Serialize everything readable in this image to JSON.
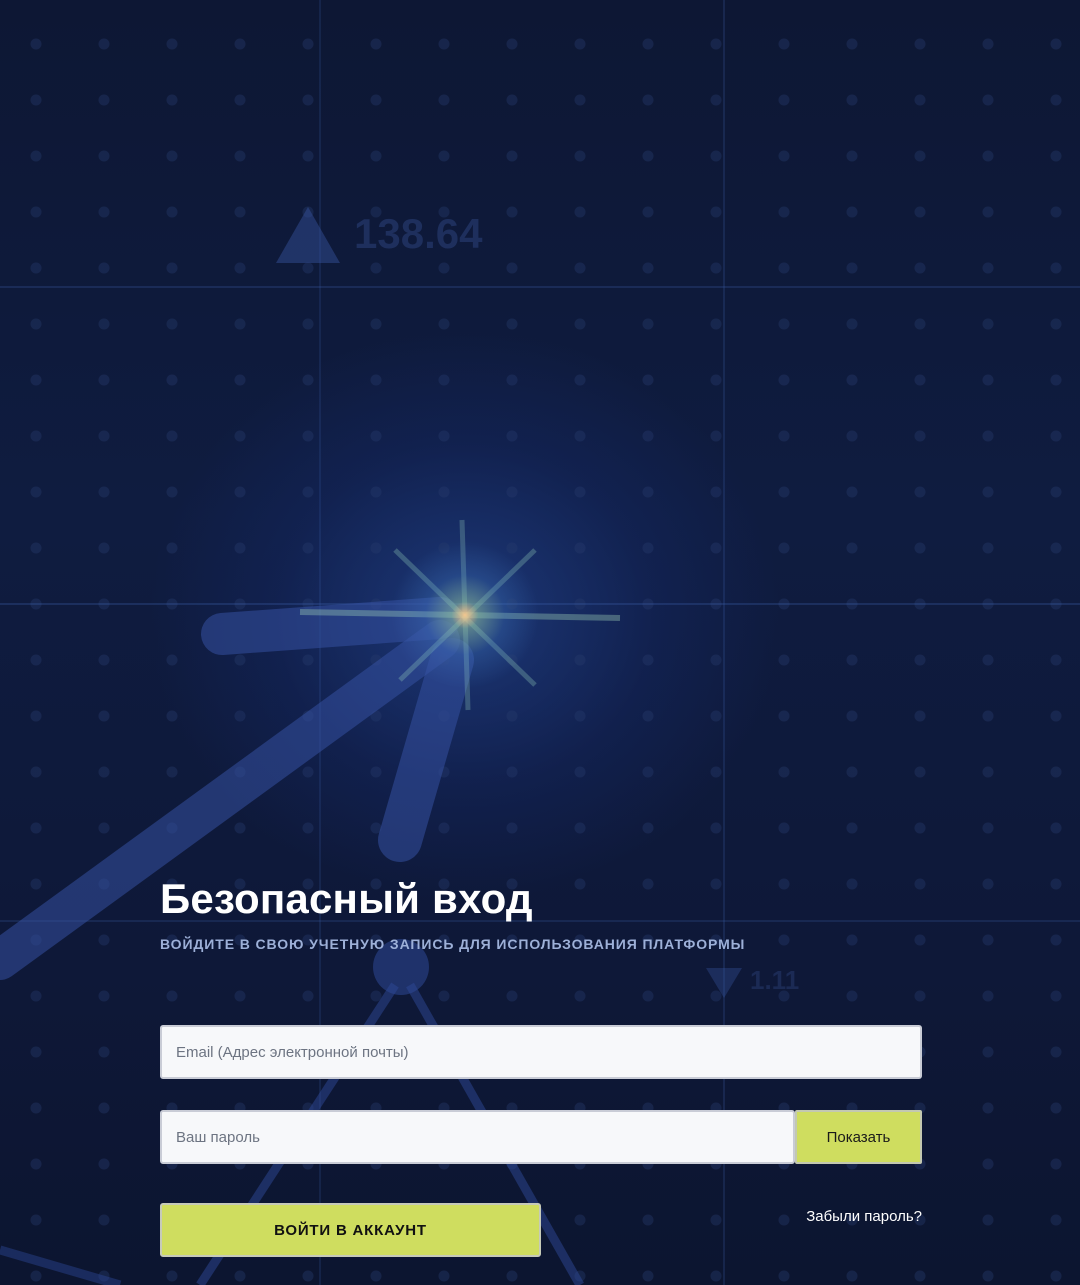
{
  "background": {
    "ticker_up_value": "138.64",
    "ticker_down_value": "1.11",
    "accent_color": "#cfdd5f",
    "base_color": "#0d1733"
  },
  "login": {
    "title": "Безопасный вход",
    "subtitle": "ВОЙДИТЕ В СВОЮ УЧЕТНУЮ ЗАПИСЬ ДЛЯ ИСПОЛЬЗОВАНИЯ ПЛАТФОРМЫ",
    "email_placeholder": "Email (Адрес электронной почты)",
    "email_value": "",
    "password_placeholder": "Ваш пароль",
    "password_value": "",
    "show_password_label": "Показать",
    "submit_label": "ВОЙТИ В АККАУНТ",
    "forgot_password_label": "Забыли пароль?"
  }
}
